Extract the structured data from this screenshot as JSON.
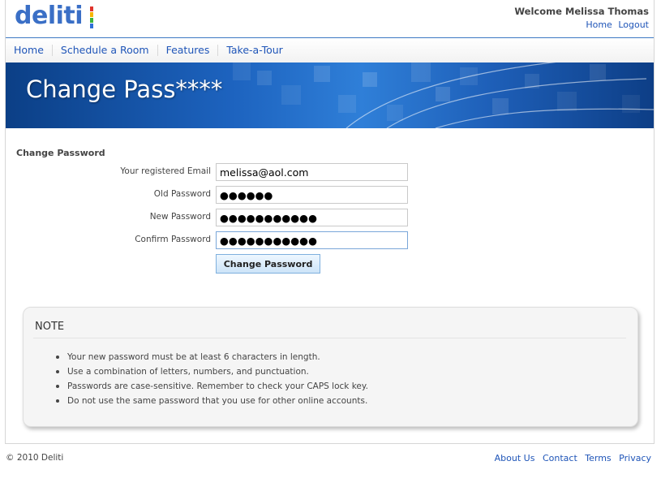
{
  "header": {
    "logo_text": "deliti",
    "logo_bar_colors": [
      "#e0332b",
      "#f7b500",
      "#3cb43c",
      "#2f6fd6"
    ],
    "welcome": "Welcome Melissa Thomas",
    "links": [
      "Home",
      "Logout"
    ]
  },
  "nav": {
    "items": [
      "Home",
      "Schedule a Room",
      "Features",
      "Take-a-Tour"
    ]
  },
  "banner": {
    "title": "Change Pass****"
  },
  "form": {
    "section_title": "Change Password",
    "fields": [
      {
        "label": "Your registered Email",
        "value": "melissa@aol.com"
      },
      {
        "label": "Old Password",
        "value": "●●●●●●"
      },
      {
        "label": "New Password",
        "value": "●●●●●●●●●●●"
      },
      {
        "label": "Confirm Password",
        "value": "●●●●●●●●●●●"
      }
    ],
    "submit_label": "Change Password"
  },
  "note": {
    "title": "NOTE",
    "items": [
      "Your new password must be at least 6 characters in length.",
      "Use a combination of letters, numbers, and punctuation.",
      "Passwords are case-sensitive. Remember to check your CAPS lock key.",
      "Do not use the same password that you use for other online accounts."
    ]
  },
  "footer": {
    "copyright": "© 2010 Deliti",
    "links": [
      "About Us",
      "Contact",
      "Terms",
      "Privacy"
    ]
  },
  "colors": {
    "link": "#1f55b8",
    "accent_border": "#3d79c4",
    "banner_dark": "#0b3f86",
    "banner_light": "#2f7fd8"
  }
}
